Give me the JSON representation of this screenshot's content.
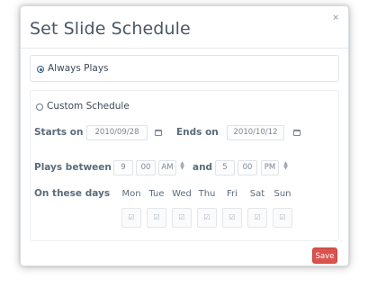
{
  "dialog": {
    "title": "Set Slide Schedule",
    "close_glyph": "×"
  },
  "options": {
    "always": {
      "label": "Always Plays",
      "selected": true
    },
    "custom": {
      "label": "Custom Schedule",
      "selected": false
    }
  },
  "dates": {
    "starts_label": "Starts on",
    "starts_value": "2010/09/28",
    "ends_label": "Ends on",
    "ends_value": "2010/10/12"
  },
  "times": {
    "label": "Plays between",
    "start_hour": "9",
    "start_min": "00",
    "start_ampm": "AM",
    "and_label": "and",
    "end_hour": "5",
    "end_min": "00",
    "end_ampm": "PM"
  },
  "days": {
    "label": "On these days",
    "names": [
      "Mon",
      "Tue",
      "Wed",
      "Thu",
      "Fri",
      "Sat",
      "Sun"
    ],
    "check_glyph": "☑"
  },
  "save_label": "Save",
  "colors": {
    "save": "#d9534f",
    "accent": "#2f5f8f"
  }
}
